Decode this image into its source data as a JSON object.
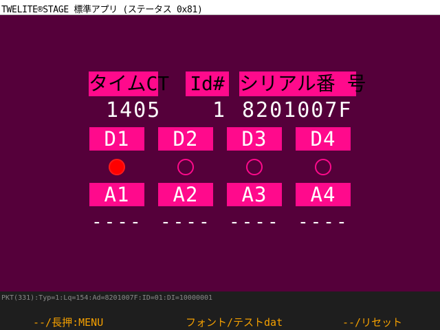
{
  "window": {
    "title": "TWELITE®STAGE 標準アプリ (ステータス 0x81)"
  },
  "headers": {
    "timer": "タイムCT",
    "id": "Id#",
    "serial": "シリアル番 号"
  },
  "values": {
    "timer": "1405",
    "id": "1",
    "serial": "8201007F"
  },
  "digital": {
    "labels": [
      "D1",
      "D2",
      "D3",
      "D4"
    ],
    "states": [
      "on",
      "off",
      "off",
      "off"
    ]
  },
  "analog": {
    "labels": [
      "A1",
      "A2",
      "A3",
      "A4"
    ],
    "values": [
      "----",
      "----",
      "----",
      "----"
    ]
  },
  "status": {
    "packet": "PKT(331):Typ=1:Lq=154:Ad=8201007F:ID=01:DI=10000001"
  },
  "footer": {
    "left": "--/長押:MENU",
    "center": "フォント/テストdat",
    "right": "--/リセット"
  },
  "colors": {
    "background": "#55003a",
    "label_bg": "#ff0a8c",
    "active": "#ff0000",
    "footer_text": "#f5a000"
  }
}
